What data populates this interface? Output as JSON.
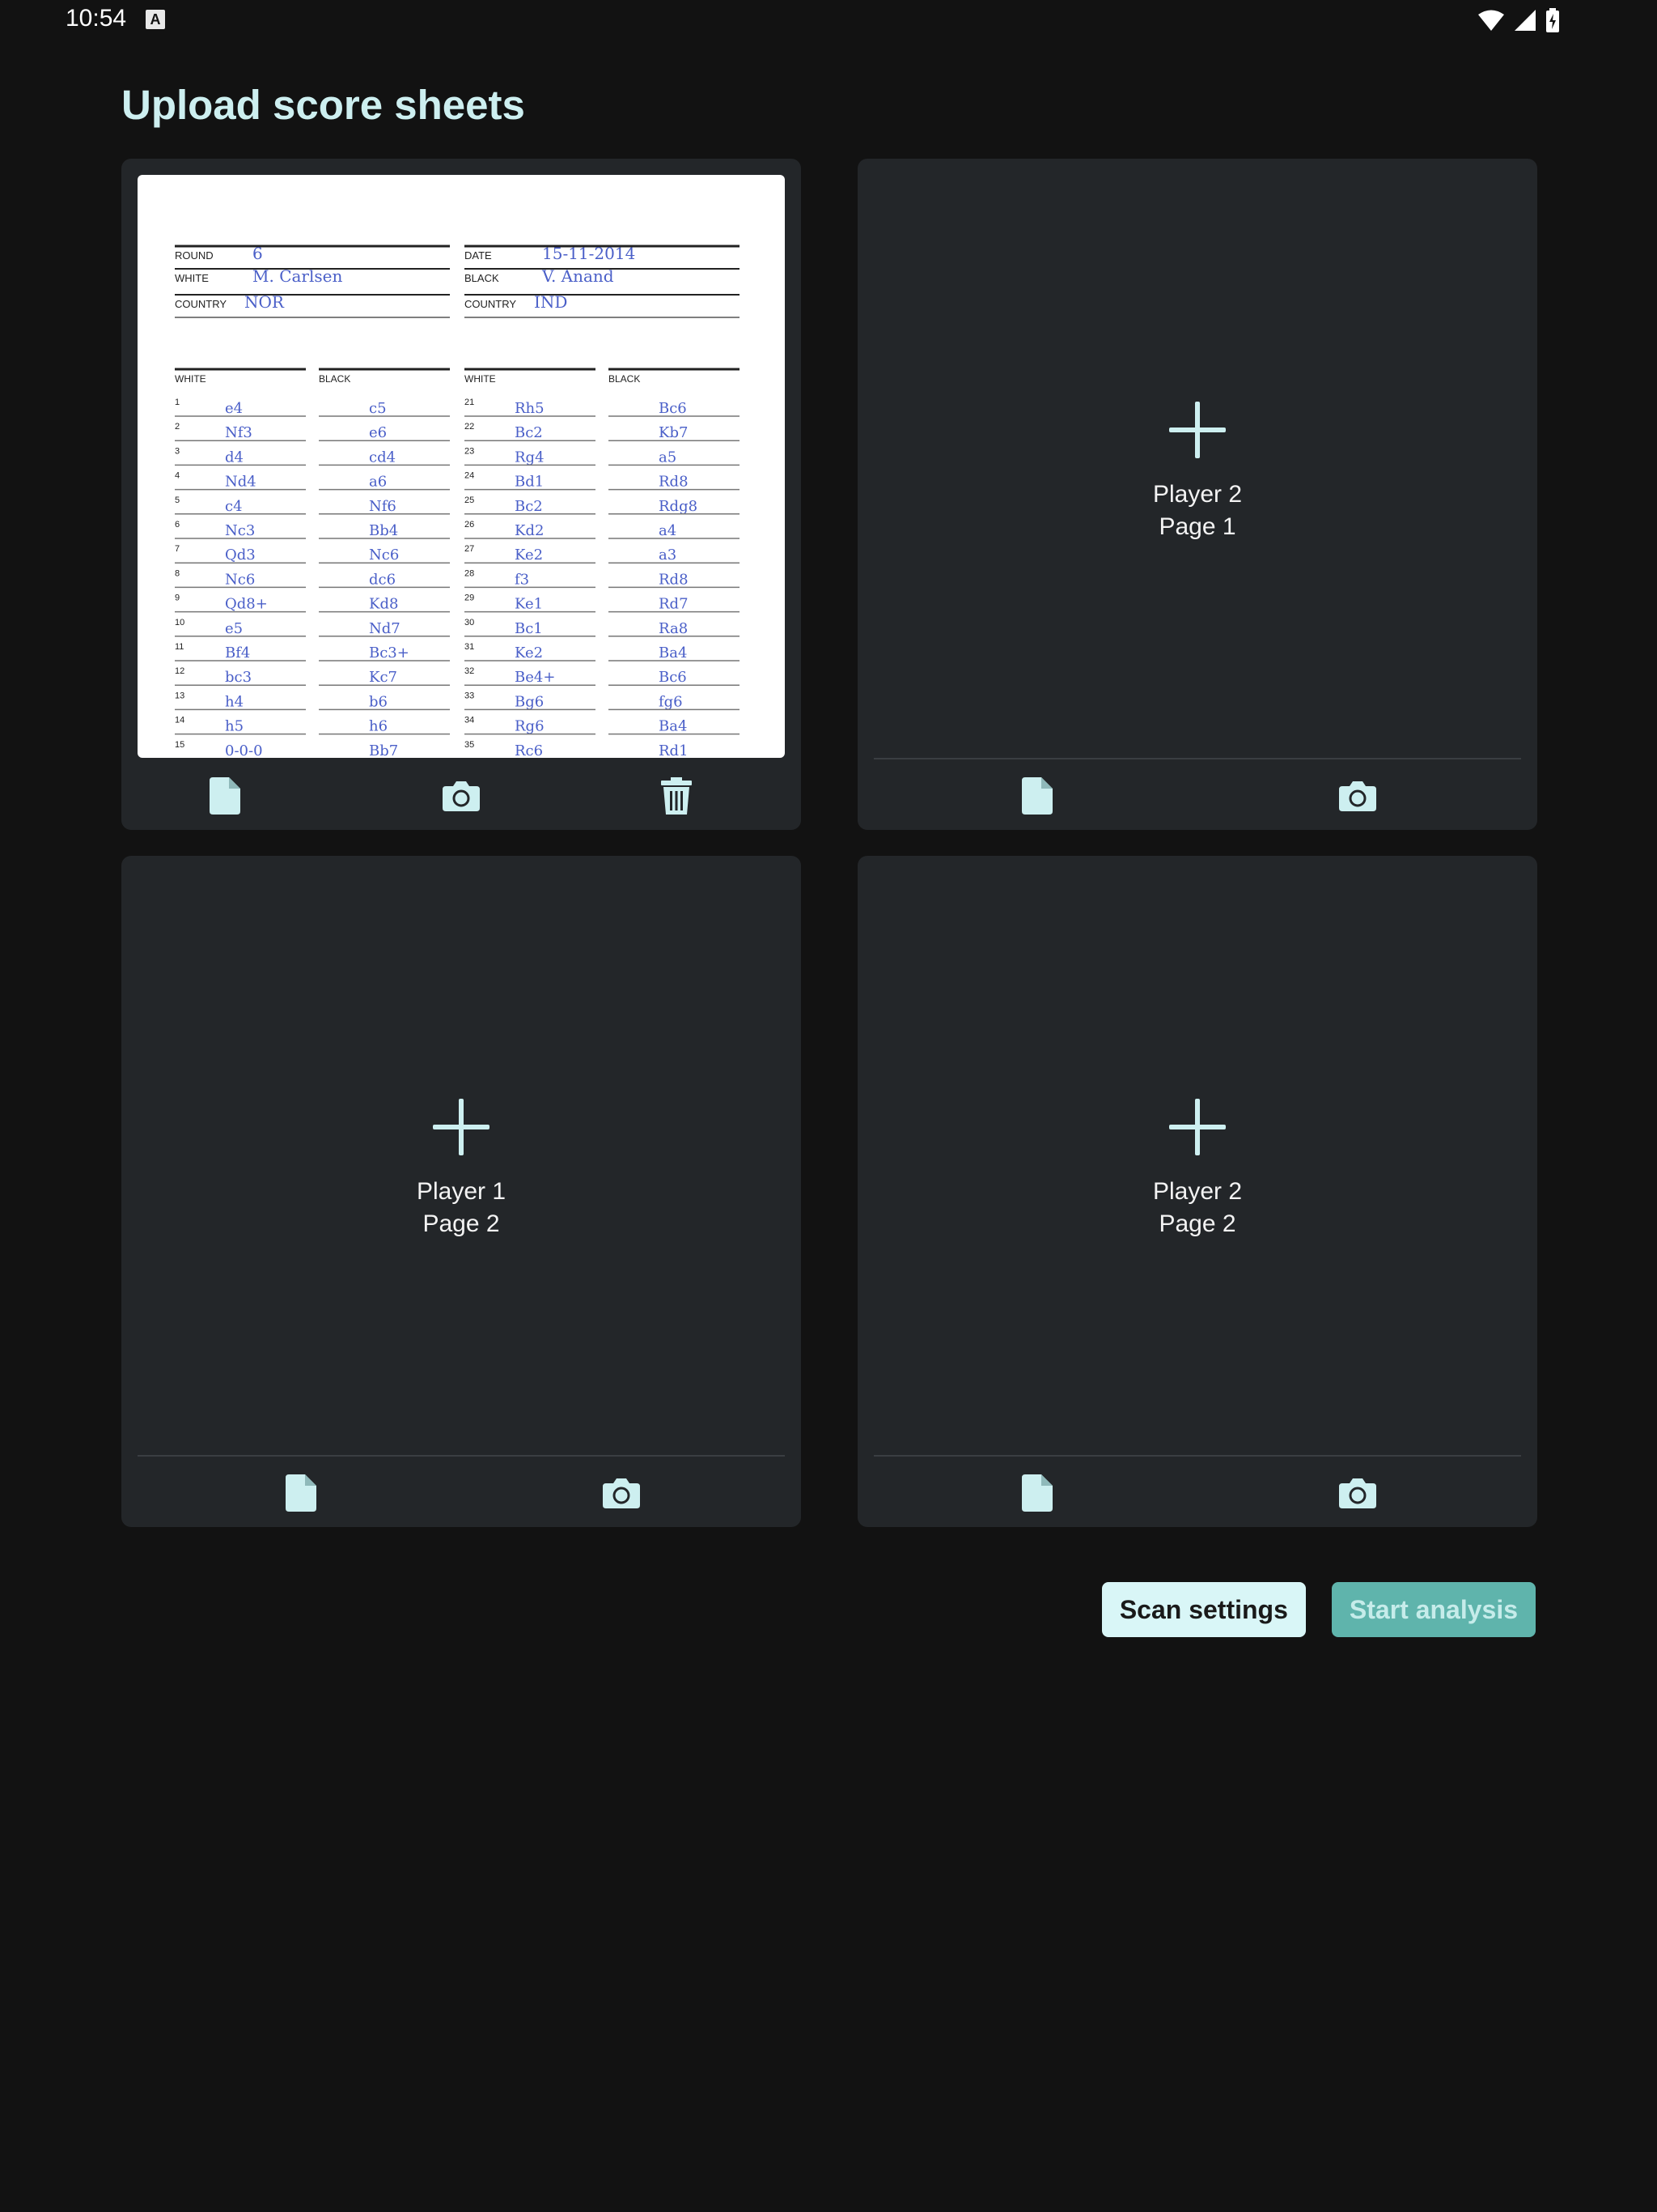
{
  "status_bar": {
    "time": "10:54",
    "notification_letter": "A",
    "icons": [
      "wifi-icon",
      "cell-signal-icon",
      "battery-charging-icon"
    ]
  },
  "page": {
    "title": "Upload score sheets"
  },
  "cards": [
    {
      "id": "player1-page1",
      "state": "filled",
      "sheet": {
        "header": [
          {
            "label": "ROUND",
            "value": "6"
          },
          {
            "label": "DATE",
            "value": "15-11-2014"
          },
          {
            "label": "WHITE",
            "value": "M. Carlsen"
          },
          {
            "label": "BLACK",
            "value": "V. Anand"
          },
          {
            "label": "COUNTRY",
            "value": "NOR"
          },
          {
            "label": "COUNTRY",
            "value": "IND"
          }
        ],
        "column_headers": [
          "WHITE",
          "BLACK",
          "WHITE",
          "BLACK"
        ],
        "moves_left": [
          [
            "1",
            "e4",
            "c5"
          ],
          [
            "2",
            "Nf3",
            "e6"
          ],
          [
            "3",
            "d4",
            "cd4"
          ],
          [
            "4",
            "Nd4",
            "a6"
          ],
          [
            "5",
            "c4",
            "Nf6"
          ],
          [
            "6",
            "Nc3",
            "Bb4"
          ],
          [
            "7",
            "Qd3",
            "Nc6"
          ],
          [
            "8",
            "Nc6",
            "dc6"
          ],
          [
            "9",
            "Qd8+",
            "Kd8"
          ],
          [
            "10",
            "e5",
            "Nd7"
          ],
          [
            "11",
            "Bf4",
            "Bc3+"
          ],
          [
            "12",
            "bc3",
            "Kc7"
          ],
          [
            "13",
            "h4",
            "b6"
          ],
          [
            "14",
            "h5",
            "h6"
          ],
          [
            "15",
            "0-0-0",
            "Bb7"
          ]
        ],
        "moves_right": [
          [
            "21",
            "Rh5",
            "Bc6"
          ],
          [
            "22",
            "Bc2",
            "Kb7"
          ],
          [
            "23",
            "Rg4",
            "a5"
          ],
          [
            "24",
            "Bd1",
            "Rd8"
          ],
          [
            "25",
            "Bc2",
            "Rdg8"
          ],
          [
            "26",
            "Kd2",
            "a4"
          ],
          [
            "27",
            "Ke2",
            "a3"
          ],
          [
            "28",
            "f3",
            "Rd8"
          ],
          [
            "29",
            "Ke1",
            "Rd7"
          ],
          [
            "30",
            "Bc1",
            "Ra8"
          ],
          [
            "31",
            "Ke2",
            "Ba4"
          ],
          [
            "32",
            "Be4+",
            "Bc6"
          ],
          [
            "33",
            "Bg6",
            "fg6"
          ],
          [
            "34",
            "Rg6",
            "Ba4"
          ],
          [
            "35",
            "Rc6",
            "Rd1"
          ]
        ]
      },
      "actions": [
        "file-icon",
        "camera-icon",
        "trash-icon"
      ]
    },
    {
      "id": "player2-page1",
      "state": "empty",
      "line1": "Player 2",
      "line2": "Page 1",
      "actions": [
        "file-icon",
        "camera-icon"
      ]
    },
    {
      "id": "player1-page2",
      "state": "empty",
      "line1": "Player 1",
      "line2": "Page 2",
      "actions": [
        "file-icon",
        "camera-icon"
      ]
    },
    {
      "id": "player2-page2",
      "state": "empty",
      "line1": "Player 2",
      "line2": "Page 2",
      "actions": [
        "file-icon",
        "camera-icon"
      ]
    }
  ],
  "buttons": {
    "scan_settings": "Scan settings",
    "start_analysis": "Start analysis"
  },
  "colors": {
    "background": "#121212",
    "card": "#232629",
    "accent": "#cdeff0",
    "start_button": "#5fb4ac",
    "ink": "#4a5fc8"
  }
}
